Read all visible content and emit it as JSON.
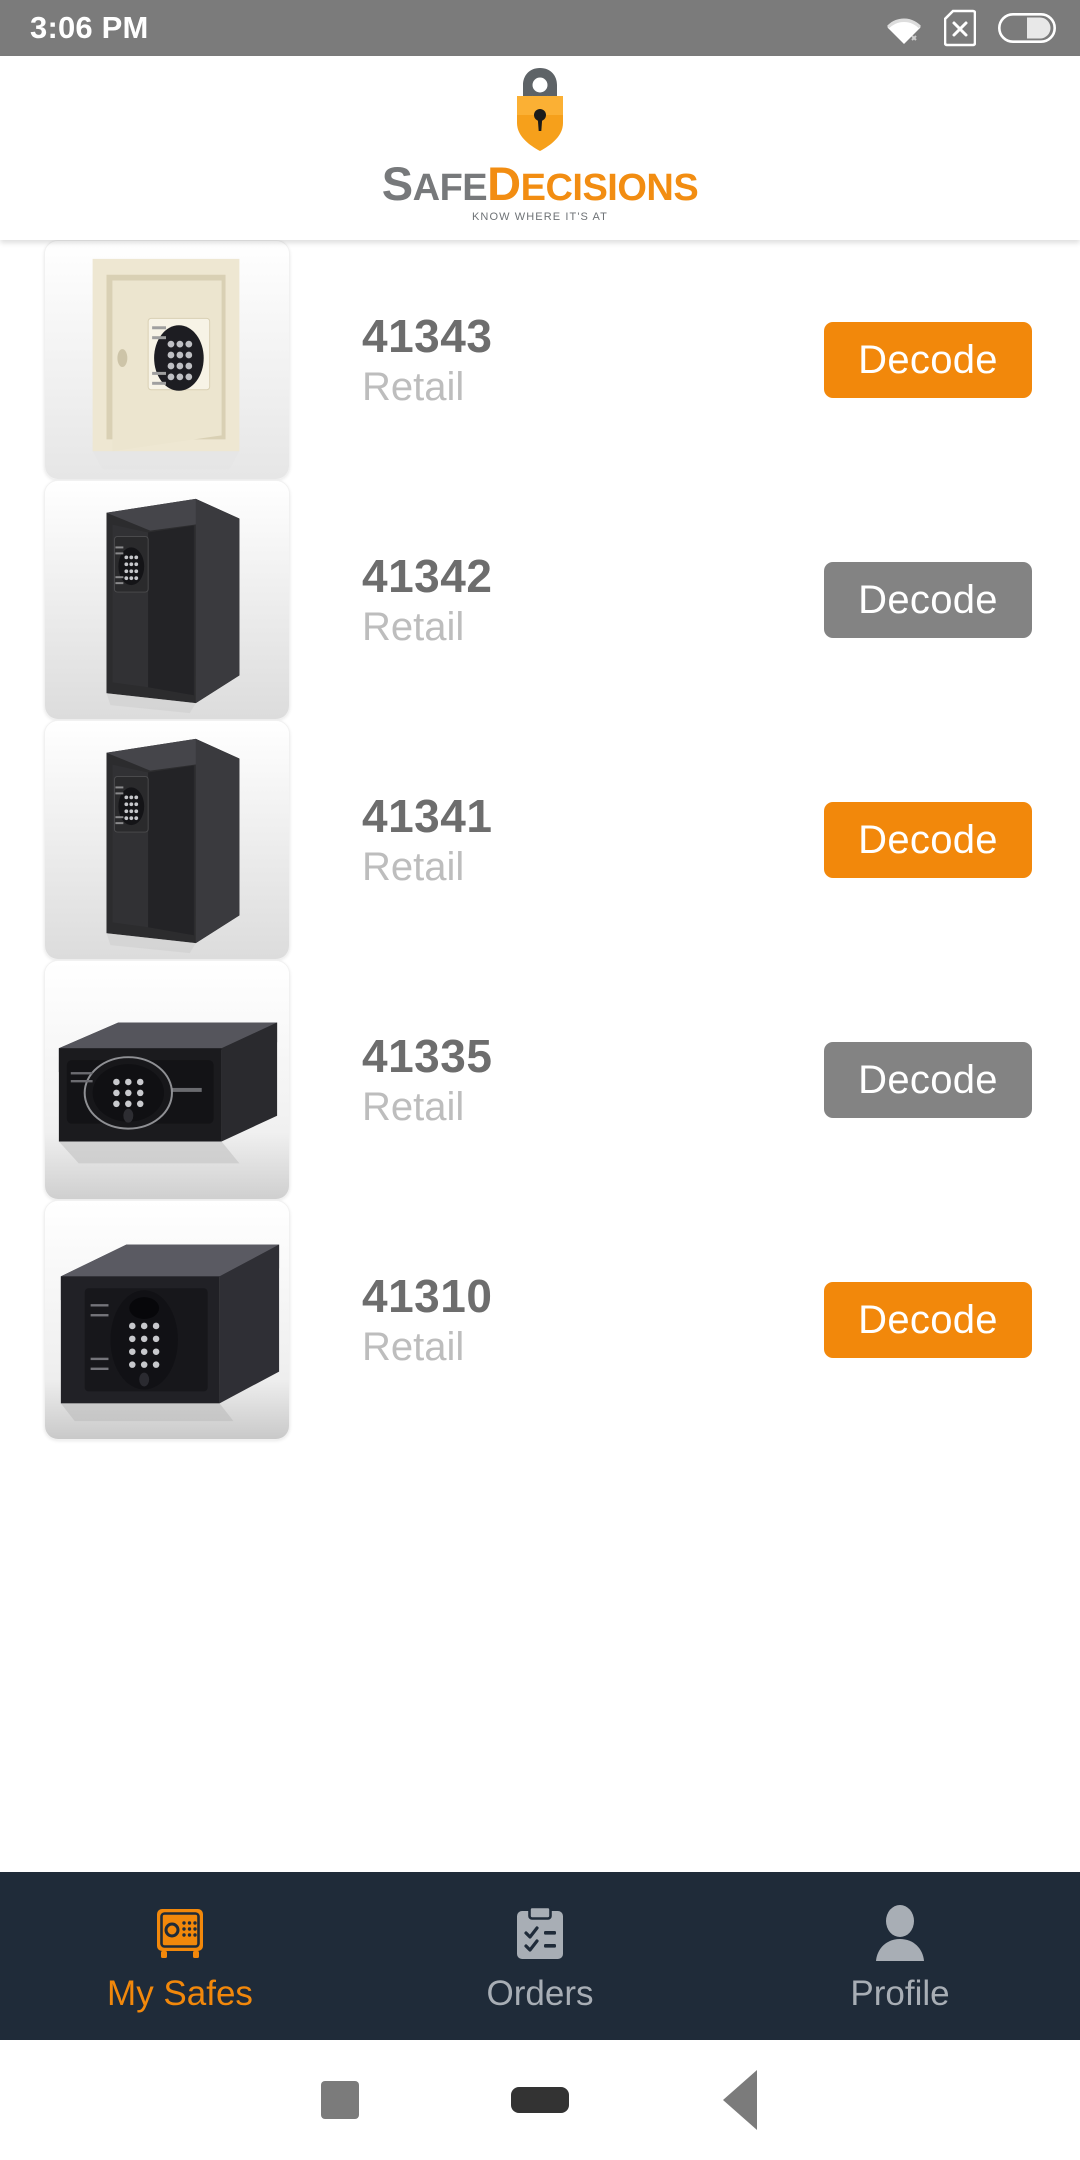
{
  "status_bar": {
    "time": "3:06 PM",
    "icons": [
      "wifi-icon",
      "sim-card-x-icon",
      "battery-icon"
    ]
  },
  "header": {
    "logo": {
      "icon": "padlock-icon",
      "word_part_1": "SAFE",
      "word_part_2": "DECISIONS",
      "tagline": "KNOW WHERE IT'S AT",
      "color_part_1": "#77797b",
      "color_part_2": "#f28d12"
    }
  },
  "main": {
    "safes": [
      {
        "id": "41343",
        "category": "Retail",
        "thumbnail": "cream-wall-safe-image",
        "action_label": "Decode",
        "action_enabled": true
      },
      {
        "id": "41342",
        "category": "Retail",
        "thumbnail": "tall-black-safe-image",
        "action_label": "Decode",
        "action_enabled": false
      },
      {
        "id": "41341",
        "category": "Retail",
        "thumbnail": "tall-black-safe-image",
        "action_label": "Decode",
        "action_enabled": true
      },
      {
        "id": "41335",
        "category": "Retail",
        "thumbnail": "wide-black-hotel-safe-image",
        "action_label": "Decode",
        "action_enabled": false
      },
      {
        "id": "41310",
        "category": "Retail",
        "thumbnail": "dark-gray-box-safe-image",
        "action_label": "Decode",
        "action_enabled": true
      }
    ]
  },
  "bottom_nav": {
    "items": [
      {
        "label": "My Safes",
        "icon": "safe-icon",
        "active": true
      },
      {
        "label": "Orders",
        "icon": "clipboard-checklist-icon",
        "active": false
      },
      {
        "label": "Profile",
        "icon": "person-icon",
        "active": false
      }
    ],
    "active_color": "#f2880b",
    "inactive_color": "#a8aeb5",
    "background": "#1f2b39"
  },
  "android_nav": {
    "buttons": [
      "recents-square-icon",
      "home-pill-icon",
      "back-triangle-icon"
    ]
  },
  "colors": {
    "accent_orange": "#f2880b",
    "disabled_gray": "#838383",
    "id_text": "#6d6d6d",
    "sub_text": "#bdbdbd"
  }
}
